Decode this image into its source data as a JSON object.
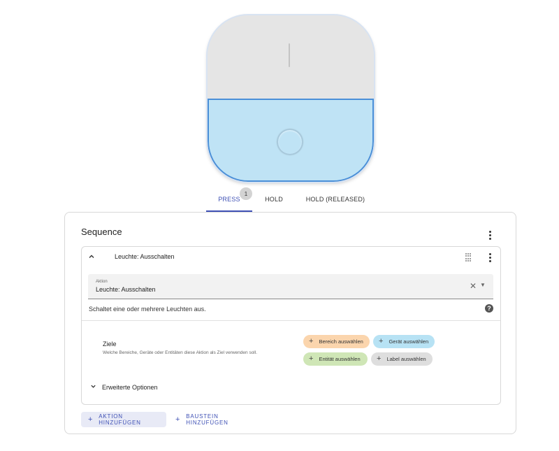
{
  "tabs": [
    {
      "label": "PRESS",
      "badge": "1",
      "active": true
    },
    {
      "label": "HOLD",
      "active": false
    },
    {
      "label": "HOLD (RELEASED)",
      "active": false
    }
  ],
  "sequence": {
    "title": "Sequence",
    "action": {
      "title": "Leuchte: Ausschalten",
      "field_label": "Aktion",
      "field_value": "Leuchte: Ausschalten",
      "description": "Schaltet eine oder mehrere Leuchten aus.",
      "targets_title": "Ziele",
      "targets_description": "Welche Bereiche, Geräte oder Entitäten diese Aktion als Ziel verwenden soll.",
      "chips": {
        "area": "Bereich auswählen",
        "device": "Gerät auswählen",
        "entity": "Entität auswählen",
        "label": "Label auswählen"
      },
      "advanced": "Erweiterte Optionen"
    }
  },
  "buttons": {
    "add_action": "AKTION HINZUFÜGEN",
    "add_block": "BAUSTEIN HINZUFÜGEN"
  },
  "colors": {
    "accent": "#3f51b5",
    "remote_selected": "#bfe3f5",
    "chip_area": "#fbd5ad",
    "chip_device": "#b7e2f4",
    "chip_entity": "#cfe6b6",
    "chip_label": "#dedede"
  },
  "icons": {
    "collapse": "chevron-up-icon",
    "expand": "chevron-down-icon",
    "menu": "more-vertical-icon",
    "drag": "drag-handle-icon",
    "clear": "close-icon",
    "dropdown": "arrow-drop-down-icon",
    "help": "help-circle-icon",
    "add": "plus-icon"
  }
}
